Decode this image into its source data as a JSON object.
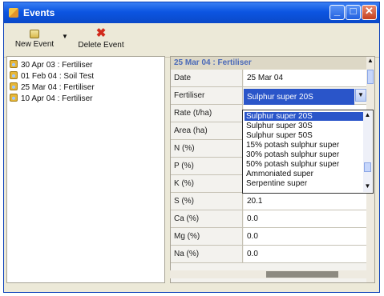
{
  "window": {
    "title": "Events",
    "controls": {
      "minimize": "_",
      "maximize": "□",
      "close": "✕"
    }
  },
  "toolbar": {
    "new_event_label": "New Event",
    "delete_event_label": "Delete Event",
    "new_event_icon": "folder-new-icon",
    "delete_event_icon": "red-x-icon"
  },
  "events_tree": {
    "items": [
      {
        "label": "30 Apr 03 : Fertiliser"
      },
      {
        "label": "01 Feb 04 : Soil Test"
      },
      {
        "label": "25 Mar 04 : Fertiliser"
      },
      {
        "label": "10 Apr 04 : Fertiliser"
      }
    ]
  },
  "details": {
    "header": "25 Mar 04 : Fertiliser",
    "rows": [
      {
        "label": "Date",
        "value": "25 Mar 04"
      },
      {
        "label": "Fertiliser",
        "value": "Sulphur super 20S"
      },
      {
        "label": "Rate (t/ha)",
        "value": ""
      },
      {
        "label": "Area (ha)",
        "value": ""
      },
      {
        "label": "N (%)",
        "value": ""
      },
      {
        "label": "P (%)",
        "value": ""
      },
      {
        "label": "K (%)",
        "value": ""
      },
      {
        "label": "S (%)",
        "value": "20.1"
      },
      {
        "label": "Ca (%)",
        "value": "0.0"
      },
      {
        "label": "Mg (%)",
        "value": "0.0"
      },
      {
        "label": "Na (%)",
        "value": "0.0"
      }
    ]
  },
  "fertiliser_dropdown": {
    "selected": "Sulphur super 20S",
    "options": [
      "Sulphur super 20S",
      "Sulphur super 30S",
      "Sulphur super 50S",
      "15% potash sulphur super",
      "30% potash sulphur super",
      "50% potash sulphur super",
      "Ammoniated super",
      "Serpentine super"
    ]
  }
}
